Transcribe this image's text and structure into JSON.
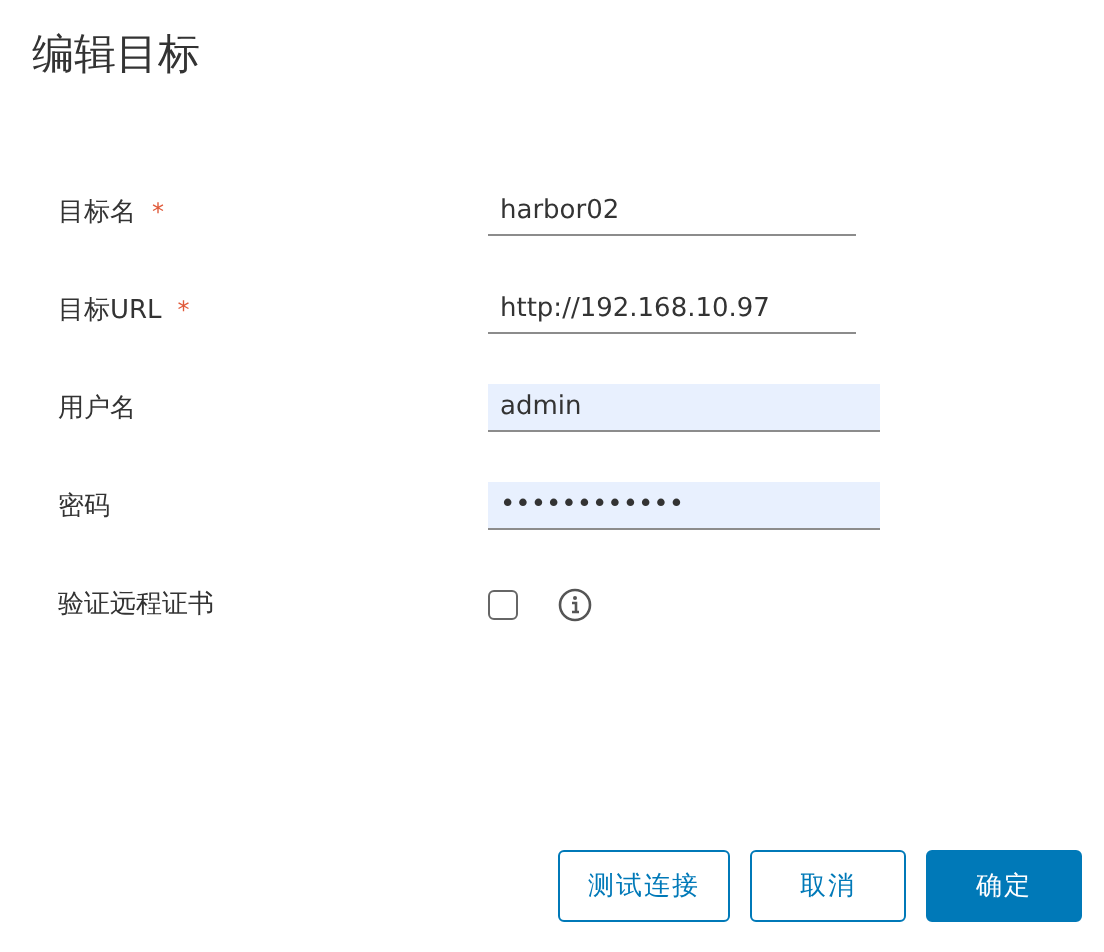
{
  "title": "编辑目标",
  "fields": [
    {
      "kind": "input",
      "label": "目标名",
      "required": true,
      "value": "harbor02",
      "autofilled": false
    },
    {
      "kind": "input",
      "label": "目标URL",
      "required": true,
      "value": "http://192.168.10.97",
      "autofilled": false
    },
    {
      "kind": "input",
      "label": "用户名",
      "required": false,
      "value": "admin",
      "autofilled": true
    },
    {
      "kind": "input",
      "label": "密码",
      "required": false,
      "value": "••••••••••••",
      "autofilled": true
    },
    {
      "kind": "checkbox",
      "label": "验证远程证书",
      "required": false,
      "checked": false
    }
  ],
  "required_mark": "*",
  "buttons": [
    {
      "label": "测试连接",
      "primary": false
    },
    {
      "label": "取消",
      "primary": false
    },
    {
      "label": "确定",
      "primary": true
    }
  ]
}
